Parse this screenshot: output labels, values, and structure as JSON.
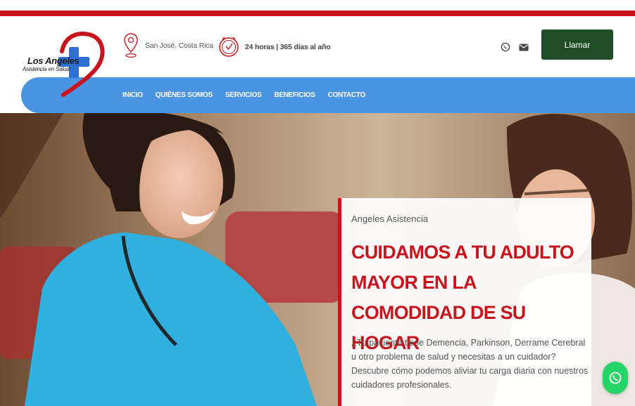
{
  "brand": {
    "name_line1": "Los Angeles",
    "name_line2": "Asistencia en Salud",
    "primary_red": "#c8141c",
    "nav_blue": "#4a94e2",
    "button_green": "#1e4d26"
  },
  "header": {
    "location_icon": "map-pin-icon",
    "location": "San José, Costa Rica",
    "hours_icon": "clock-icon",
    "hours": "24 horas | 365 días al año",
    "social_icons": [
      "whatsapp-icon",
      "envelope-icon"
    ],
    "call_label": "Llamar"
  },
  "nav": {
    "items": [
      "INICIO",
      "QUIÉNES SOMOS",
      "SERVICIOS",
      "BENEFICIOS",
      "CONTACTO"
    ]
  },
  "hero": {
    "eyebrow": "Angeles Asistencia",
    "title": "CUIDAMOS A TU ADULTO MAYOR EN LA COMODIDAD DE SU HOGAR",
    "description": "¿Tu paciente tiene Demencia, Parkinson, Derrame Cerebral u otro problema de salud y necesitas a un cuidador? Descubre cómo podemos aliviar tu carga diaria con nuestros cuidadores profesionales.",
    "image": "nurse caring for elderly woman photo"
  },
  "floating": {
    "icon": "whatsapp-icon"
  }
}
